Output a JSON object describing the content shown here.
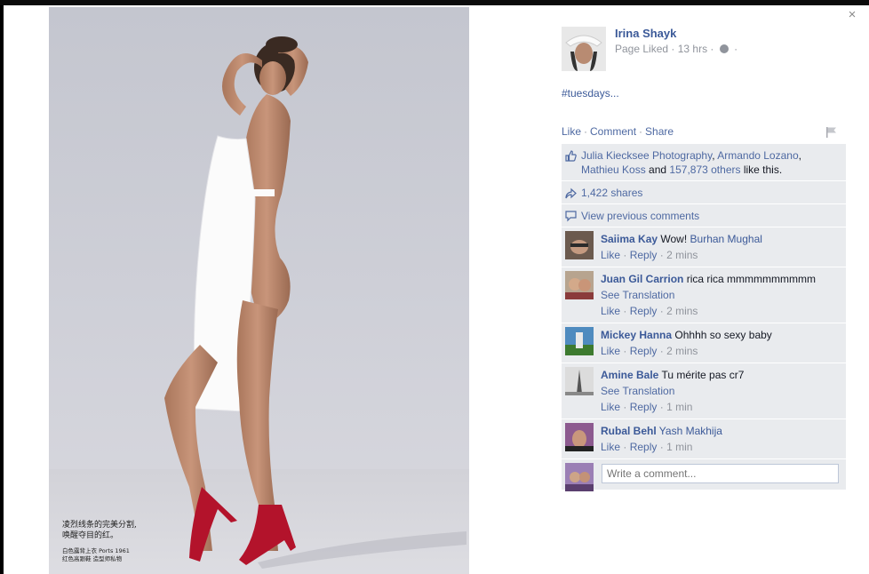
{
  "post": {
    "author": "Irina Shayk",
    "meta_text": "Page Liked · 13 hrs ·",
    "meta_dot": "·",
    "text": "#tuesdays...",
    "photo_caption_line1": "凌烈线条的完美分割,",
    "photo_caption_line2": "唤醒夺目的红。",
    "photo_caption_small1": "白色露背上衣 Ports 1961",
    "photo_caption_small2": "红色高跟鞋 造型师私物"
  },
  "actions": {
    "like": "Like",
    "comment": "Comment",
    "share": "Share",
    "sep": "·"
  },
  "likes": {
    "names": [
      "Julia Kiecksee Photography",
      "Armando Lozano",
      "Mathieu Koss"
    ],
    "comma": ",",
    "and_text": "and",
    "others": "157,873 others",
    "suffix": "like this."
  },
  "shares": "1,422 shares",
  "view_previous": "View previous comments",
  "comments": [
    {
      "name": "Saiima Kay",
      "text": "Wow!",
      "tag": "Burhan Mughal",
      "translation": "",
      "time": "2 mins"
    },
    {
      "name": "Juan Gil Carrion",
      "text": "rica rica mmmmmmmmmm",
      "tag": "",
      "translation": "See Translation",
      "time": "2 mins"
    },
    {
      "name": "Mickey Hanna",
      "text": "Ohhhh so sexy baby",
      "tag": "",
      "translation": "",
      "time": "2 mins"
    },
    {
      "name": "Amine Bale",
      "text": "Tu mérite pas cr7",
      "tag": "",
      "translation": "See Translation",
      "time": "1 min"
    },
    {
      "name": "Rubal Behl",
      "text": "",
      "tag": "Yash Makhija",
      "translation": "",
      "time": "1 min"
    }
  ],
  "comment_actions": {
    "like": "Like",
    "reply": "Reply",
    "dot": "·"
  },
  "write_placeholder": "Write a comment...",
  "close_glyph": "×",
  "colors": {
    "link": "#3b5998",
    "ufi_bg": "#e9ebee",
    "shoe_red": "#b3132b"
  },
  "icons": [
    "close-icon",
    "globe-icon",
    "flag-icon",
    "thumbs-up-icon",
    "share-icon",
    "comment-icon"
  ]
}
